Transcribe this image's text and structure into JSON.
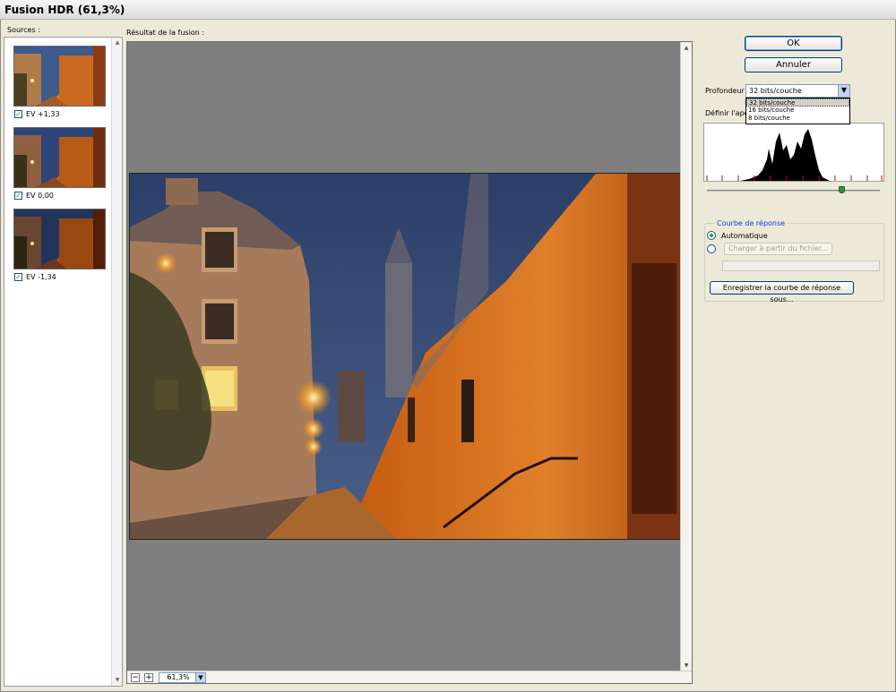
{
  "window": {
    "title": "Fusion HDR (61,3%)"
  },
  "sources": {
    "label": "Sources :",
    "items": [
      {
        "ev": "EV +1,33",
        "checked": true
      },
      {
        "ev": "EV 0,00",
        "checked": true
      },
      {
        "ev": "EV -1,34",
        "checked": true
      }
    ]
  },
  "preview": {
    "label": "Résultat de la fusion :"
  },
  "zoom": {
    "value": "61,3%",
    "minus": "−",
    "plus": "+"
  },
  "buttons": {
    "ok": "OK",
    "cancel": "Annuler"
  },
  "depth": {
    "label": "Profondeur :",
    "selected": "32 bits/couche",
    "options": [
      "32 bits/couche",
      "16 bits/couche",
      "8 bits/couche"
    ]
  },
  "white_point": {
    "label": "Définir l'aperçu du point blanc :"
  },
  "response_curve": {
    "title": "Courbe de réponse",
    "auto_label": "Automatique",
    "load_button": "Charger à partir du fichier...",
    "save_button": "Enregistrer la courbe de réponse sous..."
  },
  "colors": {
    "accent": "#0046d5",
    "check": "#21a121"
  }
}
